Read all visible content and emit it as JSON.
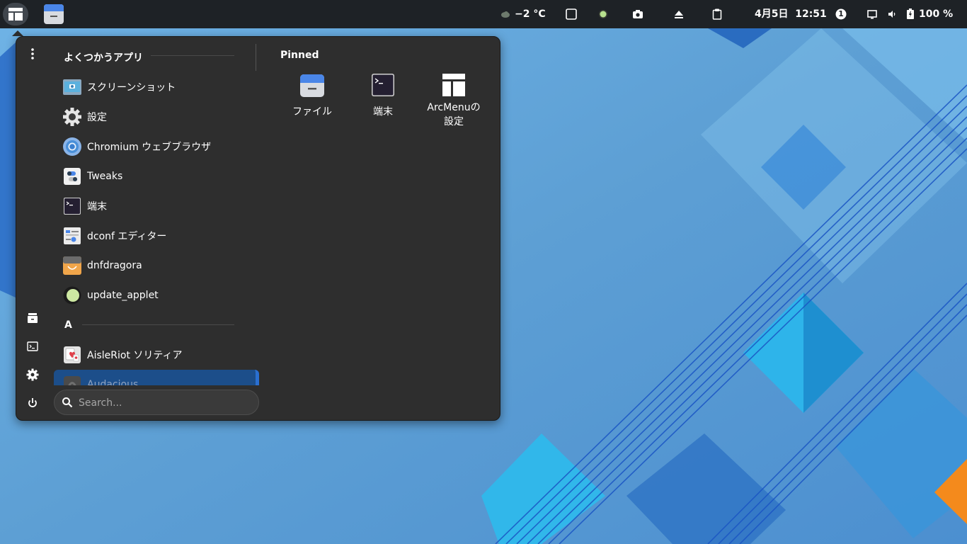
{
  "colors": {
    "panel_bg": "#1e2226",
    "menu_bg": "#2e2e2e",
    "highlight": "#1c4e8a",
    "wallpaper_base": "#5a9fd6"
  },
  "top_panel": {
    "weather": {
      "icon": "cloud-icon",
      "text": "−2 °C"
    },
    "status_icons": [
      "window-icon",
      "update-dot-icon",
      "screenshot-icon",
      "eject-icon",
      "clipboard-icon"
    ],
    "datetime": "4月5日  12:51",
    "notification_count": "1",
    "battery": "100 %"
  },
  "menu": {
    "frequent_title": "よくつかうアプリ",
    "apps": [
      {
        "label": "スクリーンショット",
        "icon": "screenshot-app-icon"
      },
      {
        "label": "設定",
        "icon": "settings-gear-icon"
      },
      {
        "label": "Chromium ウェブブラウザ",
        "icon": "chromium-icon"
      },
      {
        "label": "Tweaks",
        "icon": "tweaks-icon"
      },
      {
        "label": "端末",
        "icon": "terminal-icon"
      },
      {
        "label": "dconf エディター",
        "icon": "dconf-editor-icon"
      },
      {
        "label": "dnfdragora",
        "icon": "dnfdragora-icon"
      },
      {
        "label": "update_applet",
        "icon": "update-applet-icon"
      }
    ],
    "section_a": "A",
    "apps_a": [
      {
        "label": "AisleRiot ソリティア",
        "icon": "aisleriot-icon"
      },
      {
        "label": "Audacious",
        "icon": "audacious-icon"
      }
    ],
    "pinned_title": "Pinned",
    "pinned": [
      {
        "label": "ファイル",
        "icon": "files-icon"
      },
      {
        "label": "端末",
        "icon": "terminal-icon"
      },
      {
        "label": "ArcMenuの設定",
        "icon": "arcmenu-settings-icon"
      }
    ],
    "search_placeholder": "Search..."
  }
}
